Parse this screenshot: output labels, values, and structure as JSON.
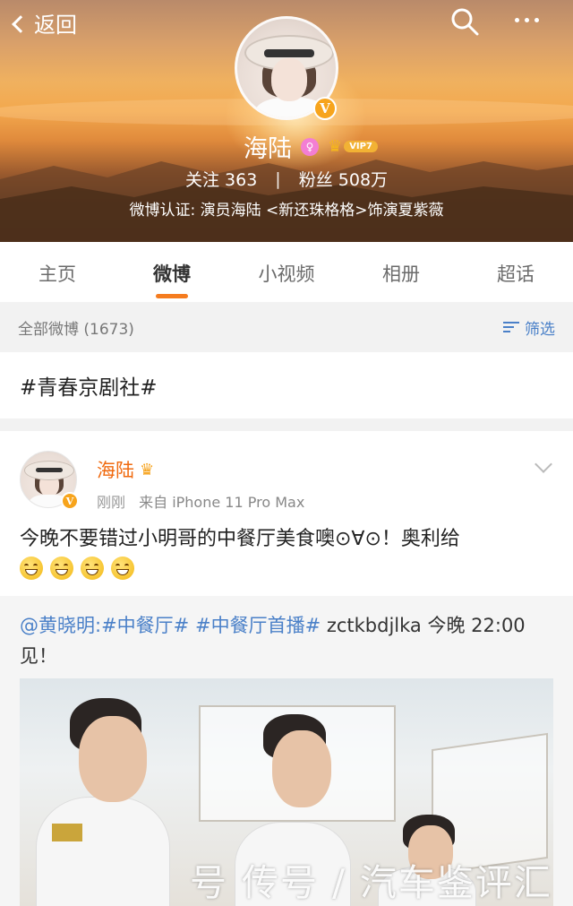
{
  "header": {
    "back_label": "返回",
    "profile_name": "海陆",
    "vip_level": "VIP7",
    "verified_badge": "V",
    "stats": {
      "following_label": "关注",
      "following_count": "363",
      "separator": "|",
      "followers_label": "粉丝",
      "followers_count": "508万"
    },
    "verification": "微博认证: 演员海陆 <新还珠格格>饰演夏紫薇"
  },
  "tabs": [
    {
      "label": "主页",
      "active": false
    },
    {
      "label": "微博",
      "active": true
    },
    {
      "label": "小视频",
      "active": false
    },
    {
      "label": "相册",
      "active": false
    },
    {
      "label": "超话",
      "active": false
    }
  ],
  "filter_bar": {
    "all_posts_label": "全部微博 (1673)",
    "filter_label": "筛选"
  },
  "topic_card": {
    "text": "#青春京剧社#"
  },
  "post": {
    "author": "海陆",
    "verified_badge": "V",
    "time": "刚刚",
    "source": "来自 iPhone 11 Pro Max",
    "text": "今晚不要错过小明哥的中餐厅美食噢⊙∀⊙！奥利给",
    "emojis": [
      "grin-icon",
      "grin-icon",
      "grin-icon",
      "grin-icon"
    ],
    "repost": {
      "mention": "@黄晓明:",
      "topic1": "#中餐厅#",
      "topic2": "#中餐厅首播#",
      "text_rest": " zctkbdjlka 今晚 22:00 见！",
      "image_watermark": "号 传号 / 汽车鉴评汇"
    }
  },
  "colors": {
    "accent_orange": "#f57c1f",
    "link_blue": "#4a80c8",
    "name_orange": "#f06a0f",
    "vip_gold": "#f2b234"
  }
}
